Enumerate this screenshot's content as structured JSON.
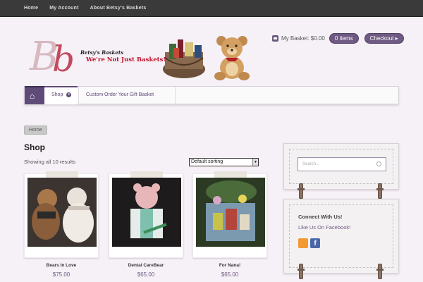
{
  "top_nav": {
    "items": [
      "Home",
      "My Account",
      "About Betsy's Baskets"
    ]
  },
  "header": {
    "logo_letters": "Bb",
    "logo_name": "Betsy's Baskets",
    "logo_tagline": "We're Not Just Baskets!"
  },
  "cart": {
    "label": "My Basket: $0.00",
    "items_label": "0 items",
    "checkout_label": "Checkout ▸"
  },
  "main_nav": {
    "home_icon": "home-icon",
    "items": [
      {
        "label": "Shop",
        "active": true
      },
      {
        "label": "Custom Order Your Gift Basket",
        "active": false
      }
    ]
  },
  "breadcrumb": {
    "label": "Home"
  },
  "shop": {
    "title": "Shop",
    "result_count": "Showing all 10 results",
    "sort_selected": "Default sorting"
  },
  "products": [
    {
      "name": "Bears In Love",
      "price": "$75.00"
    },
    {
      "name": "Dental CareBear",
      "price": "$65.00"
    },
    {
      "name": "For Nana!",
      "price": "$65.00"
    }
  ],
  "sidebar": {
    "search_placeholder": "Search...",
    "connect_title": "Connect With Us!",
    "connect_text": "Like Us On Facebook!",
    "icons": [
      "rss-icon",
      "facebook-icon"
    ]
  },
  "colors": {
    "accent": "#6e5a82",
    "topbar": "#3a3a3a",
    "background": "#f6f1f7",
    "logo_red": "#c0122a"
  }
}
